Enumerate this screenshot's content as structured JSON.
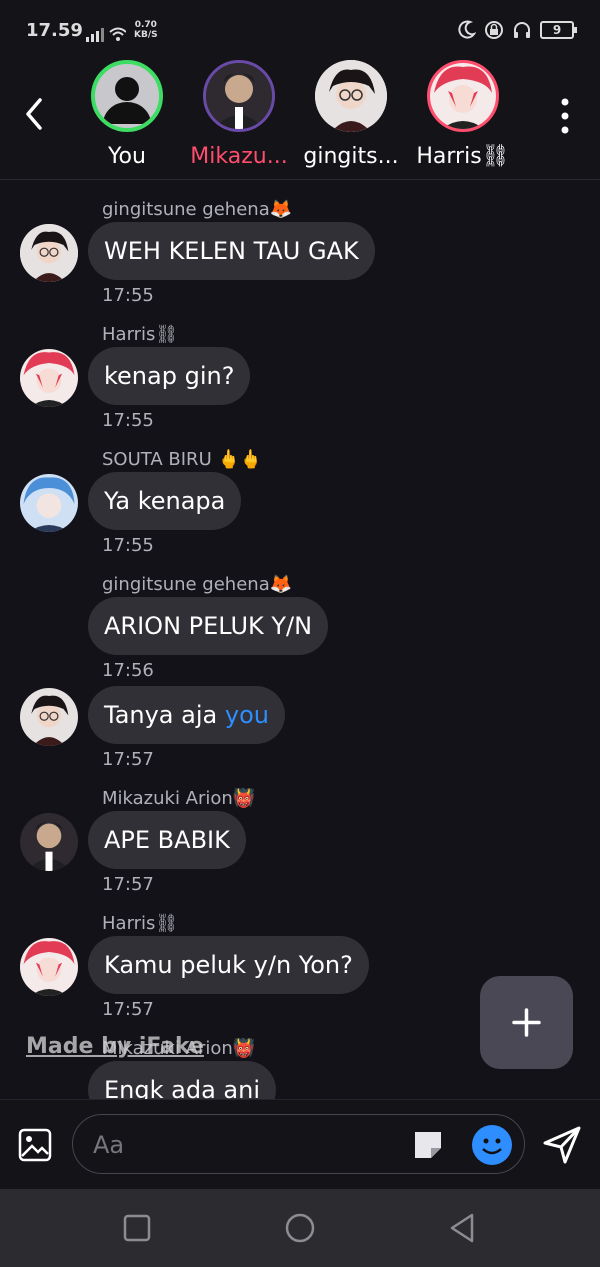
{
  "status_bar": {
    "time": "17.59",
    "net_speed_value": "0.70",
    "net_speed_unit": "KB/S",
    "battery": "9"
  },
  "header": {
    "members": [
      {
        "name": "You",
        "color": "#ffffff"
      },
      {
        "name": "Mikazu...",
        "color": "#ff4d6d"
      },
      {
        "name": "gingits...",
        "color": "#ffffff"
      },
      {
        "name": "Harris⛓",
        "color": "#ffffff"
      }
    ]
  },
  "messages": [
    {
      "sender": "gingitsune gehena🦊",
      "text": "WEH KELEN TAU GAK",
      "time": "17:55"
    },
    {
      "sender": "Harris⛓",
      "text": "kenap gin?",
      "time": "17:55"
    },
    {
      "sender": "SOUTA BIRU 🖕🖕",
      "text": "Ya kenapa",
      "time": "17:55"
    },
    {
      "sender": "gingitsune gehena🦊",
      "text": "ARION PELUK Y/N",
      "time": "17:56"
    },
    {
      "text_prefix": "Tanya aja ",
      "text_link": "you",
      "time": "17:57"
    },
    {
      "sender": "Mikazuki Arion👹",
      "text": "APE BABIK",
      "time": "17:57"
    },
    {
      "sender": "Harris⛓",
      "text": "Kamu peluk y/n Yon?",
      "time": "17:57"
    },
    {
      "sender": "Mikazuki Arion👹",
      "text": "Engk ada ani"
    }
  ],
  "watermark": "Made by iFake",
  "composer": {
    "placeholder": "Aa"
  },
  "colors": {
    "background": "#121218",
    "bubble": "#303036",
    "accent": "#2e8dff"
  }
}
